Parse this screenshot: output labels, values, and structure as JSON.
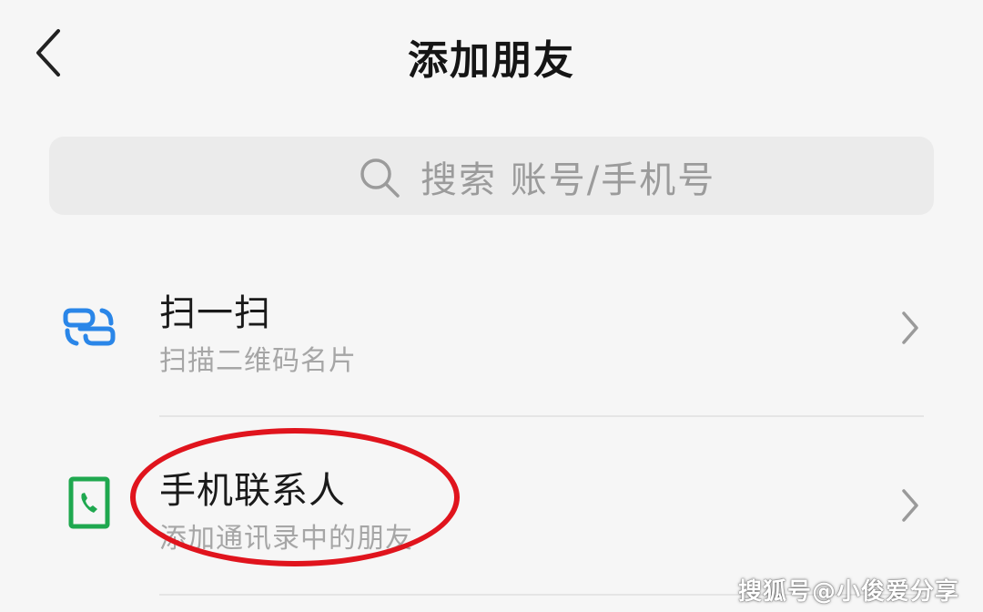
{
  "header": {
    "title": "添加朋友",
    "back_icon": "chevron-left-icon"
  },
  "search": {
    "icon": "search-icon",
    "placeholder": "搜索 账号/手机号"
  },
  "items": [
    {
      "icon": "scan-icon",
      "icon_color": "#2a86e8",
      "title": "扫一扫",
      "subtitle": "扫描二维码名片",
      "chevron": "chevron-right-icon"
    },
    {
      "icon": "phone-contact-icon",
      "icon_color": "#1fa84f",
      "title": "手机联系人",
      "subtitle": "添加通讯录中的朋友",
      "chevron": "chevron-right-icon"
    }
  ],
  "annotation": {
    "color": "#e0141d"
  },
  "watermark": "搜狐号@小俊爱分享",
  "colors": {
    "background": "#f6f6f6",
    "search_bg": "#ebebeb",
    "placeholder": "#9b9b9b",
    "subtitle": "#a6a6a6"
  }
}
